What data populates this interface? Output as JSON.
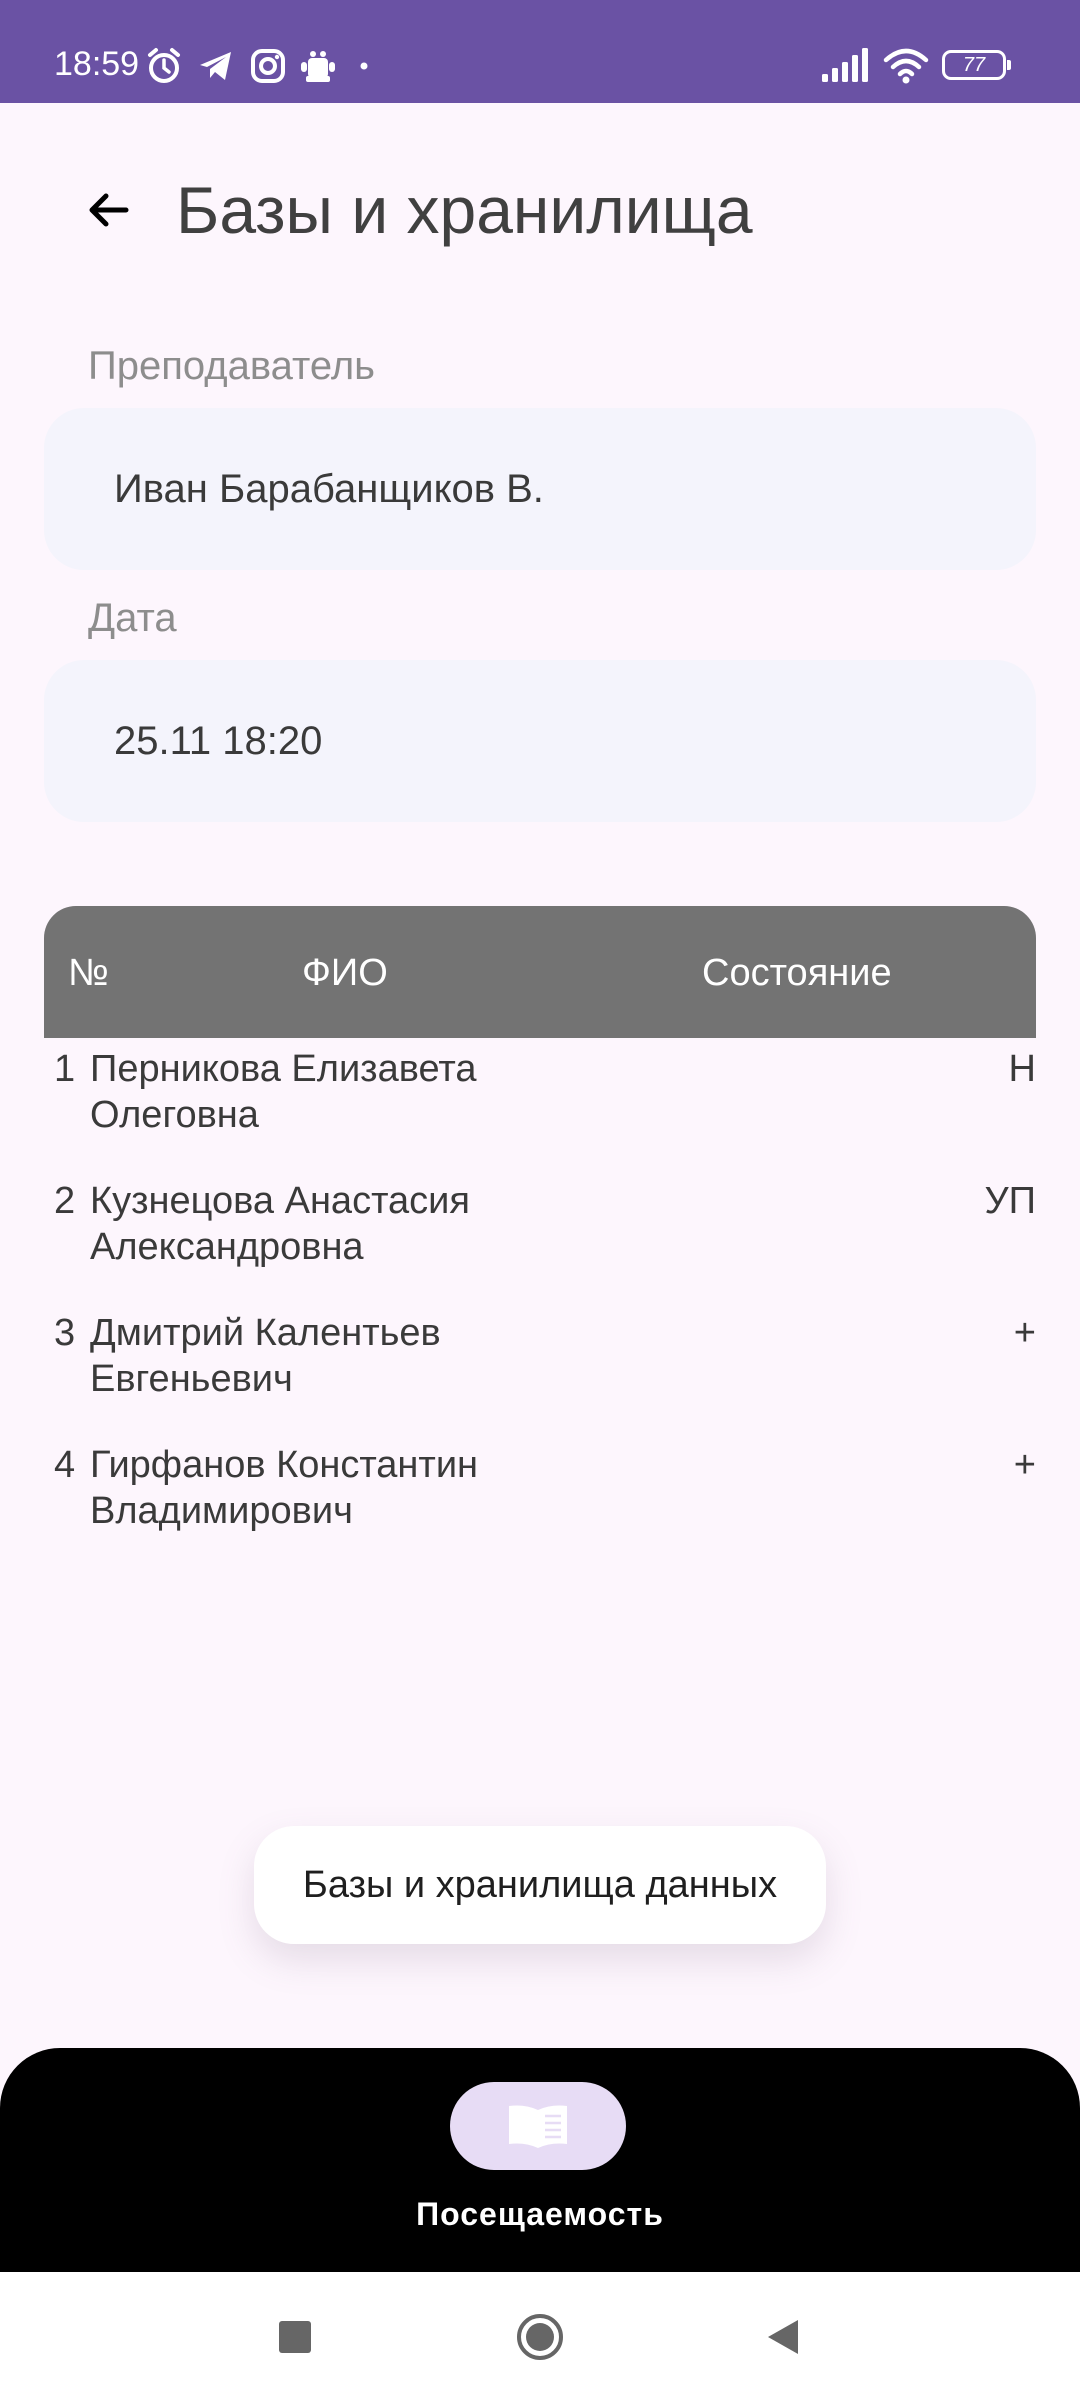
{
  "status_bar": {
    "time": "18:59",
    "battery": "77",
    "icons_left": [
      "alarm-icon",
      "telegram-icon",
      "instagram-icon",
      "app-icon",
      "dot-icon"
    ],
    "icons_right": [
      "signal-icon",
      "wifi-icon",
      "battery-icon"
    ],
    "bg_color": "#6a52a4"
  },
  "header": {
    "title": "Базы и хранилища",
    "back_icon": "arrow-left-icon"
  },
  "fields": {
    "teacher_label": "Преподаватель",
    "teacher_value": "Иван Барабанщиков В.",
    "date_label": "Дата",
    "date_value": "25.11 18:20"
  },
  "table": {
    "headers": [
      "№",
      "ФИО",
      "Состояние"
    ],
    "rows": [
      {
        "num": "1",
        "name": "Перникова Елизавета Олеговна",
        "state": "Н"
      },
      {
        "num": "2",
        "name": "Кузнецова Анастасия Александровна",
        "state": "УП"
      },
      {
        "num": "3",
        "name": "Дмитрий Калентьев Евгеньевич",
        "state": "+"
      },
      {
        "num": "4",
        "name": "Гирфанов Константин Владимирович",
        "state": "+"
      }
    ]
  },
  "toast": {
    "text": "Базы и хранилища данных"
  },
  "bottom_nav": {
    "label": "Посещаемость",
    "icon": "book-icon",
    "active_color": "#e7dcf5"
  },
  "system_nav": {
    "buttons": [
      "recents-icon",
      "home-icon",
      "back-triangle-icon"
    ]
  }
}
